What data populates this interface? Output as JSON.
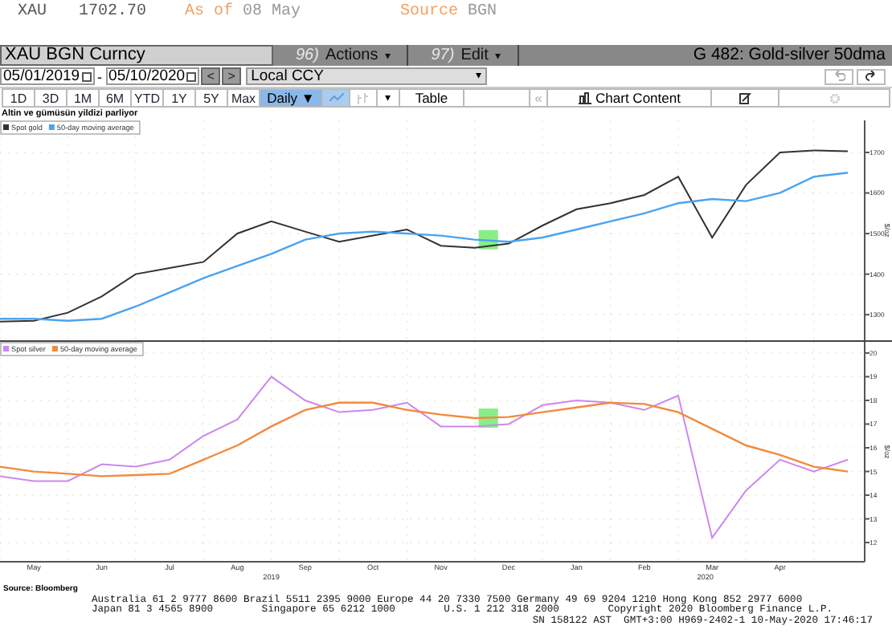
{
  "quote": {
    "ticker": "XAU",
    "price": "1702.70",
    "as_of_label": "As of",
    "as_of_date": "08 May",
    "source_label": "Source",
    "source": "BGN"
  },
  "toolbar": {
    "security": "XAU BGN Curncy",
    "menus": [
      {
        "number": "96)",
        "label": "Actions",
        "caret": "▾"
      },
      {
        "number": "97)",
        "label": "Edit",
        "caret": "▾"
      }
    ],
    "title": "G 482: Gold-silver 50dma"
  },
  "range": {
    "start": "05/01/2019",
    "separator": "-",
    "end": "05/10/2020",
    "prev": "<",
    "next": ">",
    "currency": "Local CCY",
    "caret": "▾"
  },
  "periods": [
    {
      "label": "1D",
      "selected": false
    },
    {
      "label": "3D",
      "selected": false
    },
    {
      "label": "1M",
      "selected": false
    },
    {
      "label": "6M",
      "selected": false
    },
    {
      "label": "YTD",
      "selected": false
    },
    {
      "label": "1Y",
      "selected": false
    },
    {
      "label": "5Y",
      "selected": false
    },
    {
      "label": "Max",
      "selected": false
    }
  ],
  "frequency": {
    "label": "Daily ▼",
    "selected": true
  },
  "chart_types": [
    {
      "kind": "line",
      "selected": true
    },
    {
      "kind": "bar",
      "selected": false
    }
  ],
  "style_caret": "▾",
  "table_label": "Table",
  "collapse": "«",
  "chart_content": "Chart Content",
  "chart_title": "Altin ve gümüsün yildizi parliyor",
  "charts": [
    {
      "chart_data": {
        "type": "line",
        "ylabel": "$/oz",
        "categories": [
          null,
          null,
          null,
          null,
          null,
          null,
          null,
          null,
          null,
          null,
          null,
          null,
          null,
          null,
          null,
          null,
          null,
          null,
          null,
          null,
          null,
          null,
          null,
          null,
          null,
          null
        ],
        "grid": true,
        "legend": "top-left",
        "ylim": [
          1237,
          1779
        ],
        "yticks": [
          1300,
          1400,
          1500,
          1600,
          1700
        ],
        "series": [
          {
            "name": "Spot gold",
            "color": "#333333",
            "values": [
              1283,
              1285,
              1305,
              1345,
              1400,
              1415,
              1430,
              1500,
              1530,
              1505,
              1480,
              1495,
              1510,
              1470,
              1465,
              1475,
              1520,
              1560,
              1575,
              1595,
              1640,
              1490,
              1620,
              1700,
              1705,
              1703
            ]
          },
          {
            "name": "50-day moving average",
            "color": "#4aa3f0",
            "values": [
              1290,
              1290,
              1285,
              1290,
              1320,
              1355,
              1390,
              1420,
              1450,
              1485,
              1500,
              1505,
              1500,
              1495,
              1485,
              1480,
              1490,
              1510,
              1530,
              1550,
              1575,
              1585,
              1580,
              1600,
              1640,
              1650
            ]
          }
        ]
      }
    },
    {
      "chart_data": {
        "type": "line",
        "ylabel": "$/oz",
        "categories": [
          null,
          "May",
          null,
          "Jun",
          null,
          "Jul",
          null,
          "Aug",
          null,
          "Sep",
          null,
          "Oct",
          null,
          "Nov",
          null,
          "Dec",
          null,
          "Jan",
          null,
          "Feb",
          null,
          "Mar",
          null,
          "Apr",
          null,
          null
        ],
        "grid": true,
        "legend": "top-left",
        "ylim": [
          11.19,
          20.47
        ],
        "yticks": [
          12,
          13,
          14,
          15,
          16,
          17,
          18,
          19,
          20
        ],
        "series": [
          {
            "name": "Spot silver",
            "color": "#cc88ee",
            "values": [
              14.8,
              14.6,
              14.6,
              15.3,
              15.2,
              15.5,
              16.5,
              17.2,
              19.0,
              18.0,
              17.5,
              17.6,
              17.9,
              16.9,
              16.9,
              17.0,
              17.8,
              18.0,
              17.9,
              17.6,
              18.2,
              12.2,
              14.2,
              15.5,
              15.0,
              15.5
            ]
          },
          {
            "name": "50-day moving average",
            "color": "#f28a3c",
            "values": [
              15.2,
              15.0,
              14.9,
              14.8,
              14.85,
              14.9,
              15.5,
              16.1,
              16.9,
              17.6,
              17.9,
              17.9,
              17.6,
              17.4,
              17.25,
              17.3,
              17.5,
              17.7,
              17.9,
              17.85,
              17.5,
              16.8,
              16.1,
              15.7,
              15.2,
              15.0
            ]
          }
        ]
      },
      "year_labels": [
        "2019",
        "2020"
      ]
    }
  ],
  "source_note": "Source: Bloomberg",
  "footer": [
    "Australia 61 2 9777 8600 Brazil 5511 2395 9000 Europe 44 20 7330 7500 Germany 49 69 9204 1210 Hong Kong 852 2977 6000",
    "Japan 81 3 4565 8900        Singapore 65 6212 1000        U.S. 1 212 318 2000        Copyright 2020 Bloomberg Finance L.P.",
    "SN 158122 AST  GMT+3:00 H969-2402-1 10-May-2020 17:46:17"
  ]
}
